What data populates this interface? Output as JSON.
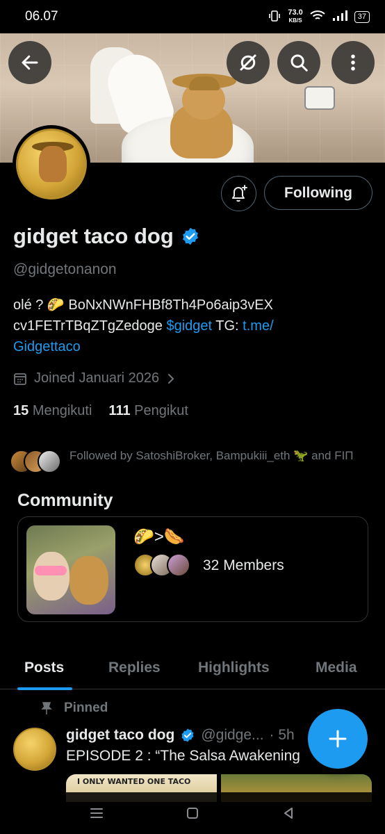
{
  "status_bar": {
    "time": "06.07",
    "net_speed_value": "73.0",
    "net_speed_unit": "KB/S",
    "battery": "37"
  },
  "banner": {
    "back_icon": "arrow-left-icon",
    "icons": [
      "unfollow-slash-icon",
      "search-icon",
      "more-vertical-icon"
    ]
  },
  "profile": {
    "name": "gidget taco dog",
    "handle": "@gidgetonanon",
    "verified": true,
    "bio_line1": "olé ? 🌮 BoNxNWnFHBf8Th4Po6aip3vEX",
    "bio_line2_prefix": "cv1FETrTBqZTgZedoge ",
    "bio_cashtag": "$gidget",
    "bio_tg": " TG: ",
    "bio_link_part1": "t.me/",
    "bio_link_part2": "Gidgettaco",
    "joined": "Joined Januari 2026",
    "following_count": "15",
    "following_label": "Mengikuti",
    "followers_count": "111",
    "followers_label": "Pengikut",
    "followed_by": "Followed by SatoshiBroker, Bampukiii_eth 🦖 and FIΠ"
  },
  "actions": {
    "follow_label": "Following",
    "bell_icon": "bell-plus-icon"
  },
  "community": {
    "title": "Community",
    "emoji_line": "🌮>🌭",
    "members": "32 Members"
  },
  "tabs": [
    "Posts",
    "Replies",
    "Highlights",
    "Media"
  ],
  "active_tab": "Posts",
  "pinned_post": {
    "pinned_label": "Pinned",
    "name": "gidget taco dog",
    "handle": "@gidge...",
    "time": "· 5h",
    "text": "EPISODE 2 : “The Salsa Awakening",
    "media_caption": "I ONLY WANTED ONE TACO"
  },
  "colors": {
    "accent": "#1d9bf0",
    "background": "#000000",
    "secondary_text": "#71767b",
    "primary_text": "#e7e9ea"
  }
}
